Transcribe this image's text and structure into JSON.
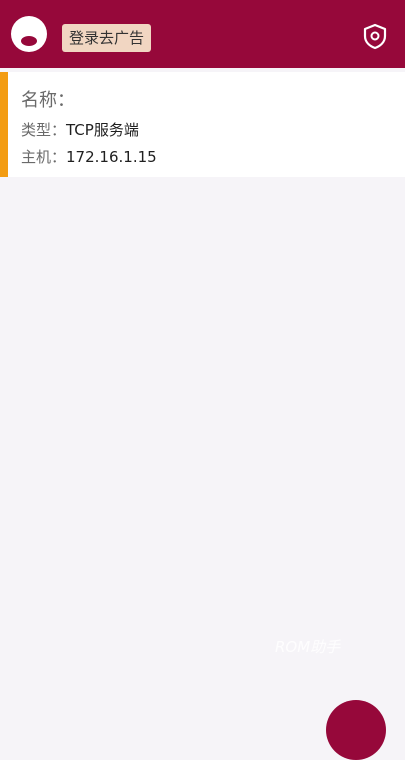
{
  "appbar": {
    "ad_button_label": "登录去广告",
    "icons": {
      "avatar": "avatar-icon",
      "right": "shield-icon"
    }
  },
  "connection": {
    "name_label": "名称：",
    "name_value": "",
    "type_label": "类型：",
    "type_value": "TCP服务端",
    "host_label": "主机：",
    "host_value": "172.16.1.15"
  },
  "watermark": "ROM助手",
  "colors": {
    "primary": "#96083a",
    "accent": "#f39c12",
    "background": "#f6f4f8",
    "chip": "#f1d6c2"
  }
}
